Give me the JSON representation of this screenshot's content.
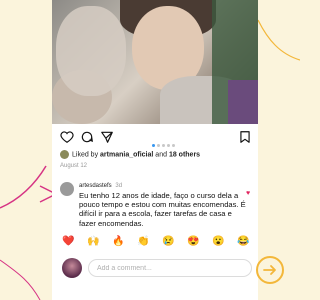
{
  "post": {
    "liked_by_prefix": "Liked by",
    "liked_by_user": "artmania_oficial",
    "liked_by_and": "and",
    "liked_by_others": "18 others",
    "date": "August 12",
    "carousel_count": 5,
    "carousel_active": 1
  },
  "comment": {
    "username": "artesdastefs",
    "time": "3d",
    "text": "Eu tenho 12 anos de idade, faço o curso dela a pouco tempo e estou com muitas encomendas. É difícil ir para a escola, fazer tarefas de casa e fazer encomendas."
  },
  "emojis": [
    "❤️",
    "🙌",
    "🔥",
    "👏",
    "😢",
    "😍",
    "😮",
    "😂"
  ],
  "composer": {
    "placeholder": "Add a comment..."
  },
  "colors": {
    "background": "#fbf4dc",
    "accent_arrow": "#f3b73a",
    "deco_line": "#d63384",
    "heart": "#e0245e",
    "carousel_active_dot": "#3897f0"
  }
}
